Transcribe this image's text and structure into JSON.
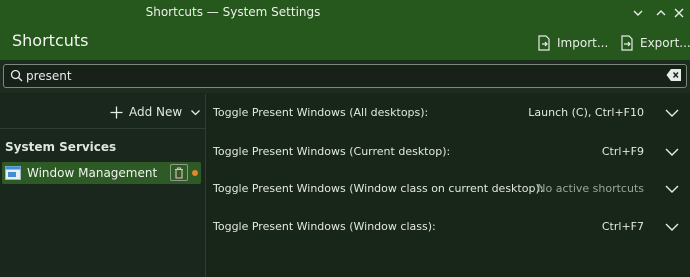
{
  "window": {
    "title": "Shortcuts — System Settings"
  },
  "header": {
    "page_title": "Shortcuts",
    "import_label": "Import...",
    "export_label": "Export..."
  },
  "search": {
    "value": "present",
    "placeholder": ""
  },
  "sidebar": {
    "add_new_label": "Add New",
    "section_title": "System Services",
    "items": [
      {
        "label": "Window Management",
        "selected": true,
        "modified": true
      }
    ]
  },
  "shortcuts": [
    {
      "name": "Toggle Present Windows (All desktops):",
      "keys": "Launch (C), Ctrl+F10"
    },
    {
      "name": "Toggle Present Windows (Current desktop):",
      "keys": "Ctrl+F9"
    },
    {
      "name": "Toggle Present Windows (Window class on current desktop):",
      "keys": "No active shortcuts"
    },
    {
      "name": "Toggle Present Windows (Window class):",
      "keys": "Ctrl+F7"
    }
  ],
  "colors": {
    "accent": "#26581e",
    "background": "#18261a",
    "selection": "#2e5a25",
    "modified_dot": "#e8872a"
  },
  "icons": [
    "chevron-down-icon",
    "minimize-icon",
    "close-icon",
    "import-icon",
    "export-icon",
    "search-icon",
    "clear-icon",
    "plus-icon",
    "app-window-icon",
    "trash-icon"
  ]
}
